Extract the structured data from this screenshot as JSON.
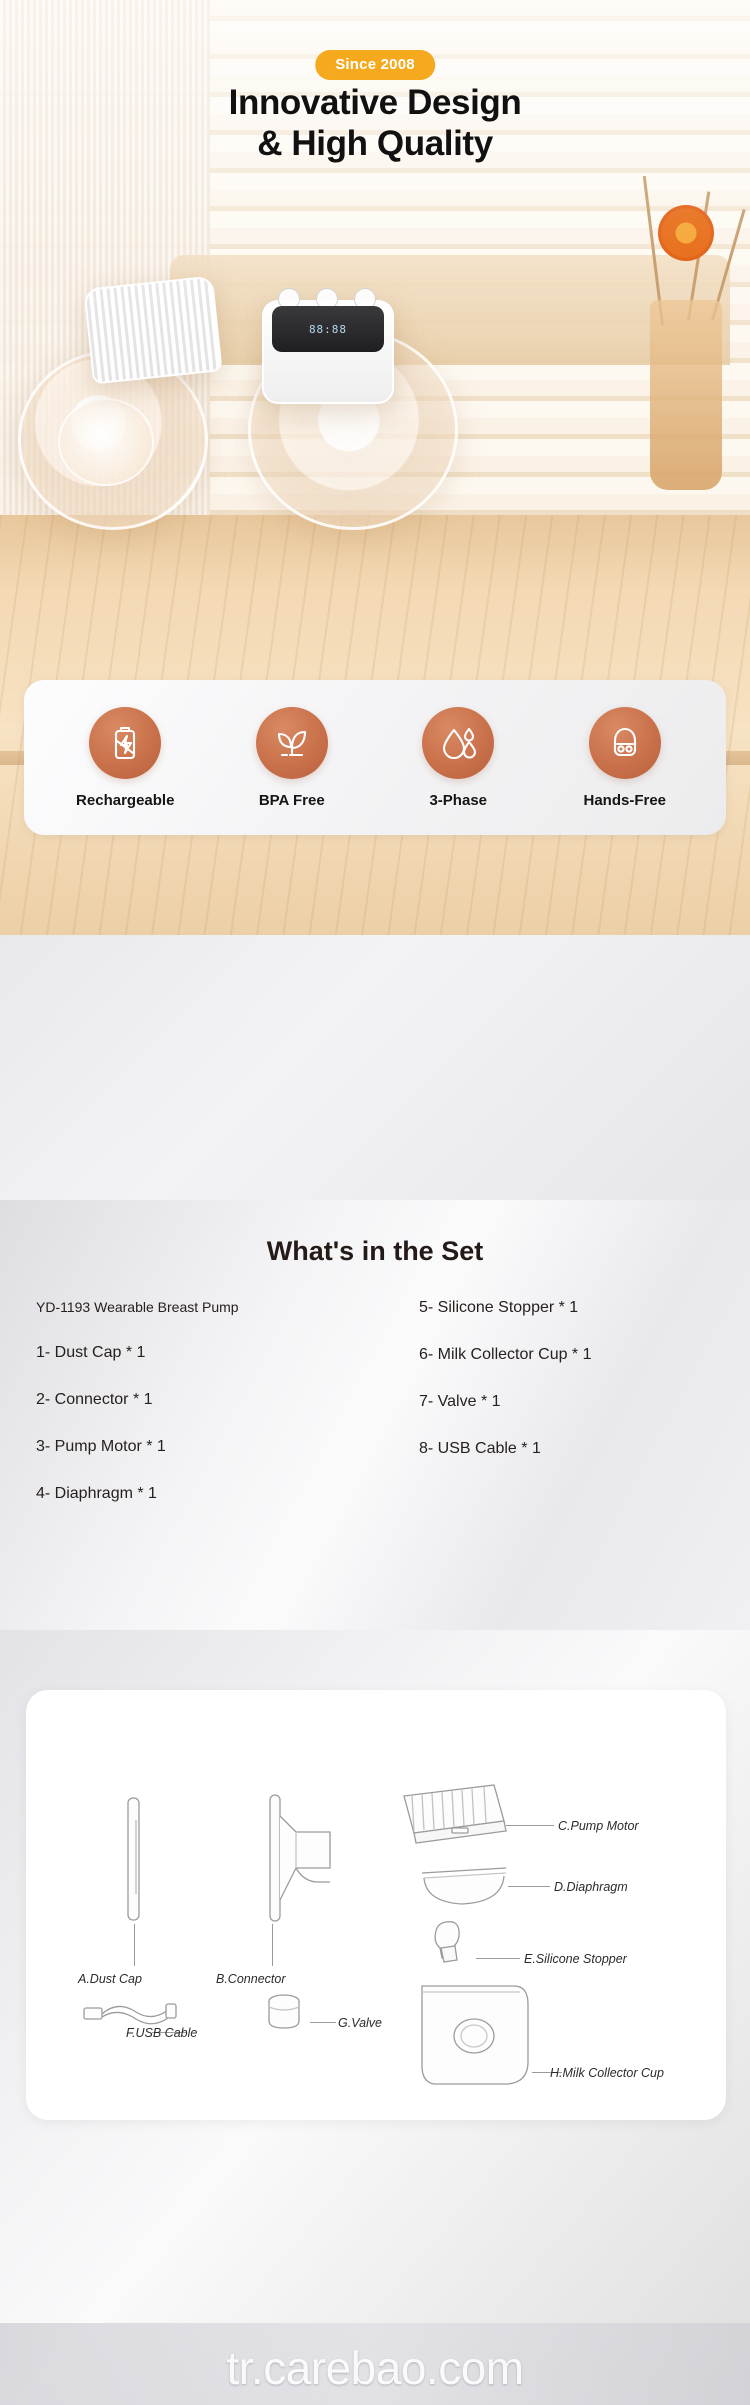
{
  "hero": {
    "since_badge": "Since 2008",
    "title_line1": "Innovative Design",
    "title_line2": "& High Quality",
    "lcd_text": "88:88"
  },
  "features": {
    "items": [
      {
        "icon": "battery-charging-icon",
        "label": "Rechargeable"
      },
      {
        "icon": "leaf-plant-icon",
        "label": "BPA Free"
      },
      {
        "icon": "water-drops-icon",
        "label": "3-Phase"
      },
      {
        "icon": "hands-free-pump-icon",
        "label": "Hands-Free"
      }
    ],
    "accent_color": "#c9714b"
  },
  "set": {
    "title": "What's in the Set",
    "left_items": [
      "YD-1193 Wearable Breast Pump",
      "1- Dust Cap * 1",
      "2- Connector * 1",
      "3- Pump Motor * 1",
      "4- Diaphragm * 1"
    ],
    "right_items": [
      "5- Silicone Stopper * 1",
      "6- Milk Collector Cup * 1",
      "7- Valve * 1",
      "8- USB Cable * 1"
    ]
  },
  "diagram": {
    "labels": {
      "a": "A.Dust Cap",
      "b": "B.Connector",
      "c": "C.Pump Motor",
      "d": "D.Diaphragm",
      "e": "E.Silicone Stopper",
      "f": "F.USB Cable",
      "g": "G.Valve",
      "h": "H.Milk Collector Cup"
    }
  },
  "watermark": {
    "text": "tr.carebao.com"
  }
}
